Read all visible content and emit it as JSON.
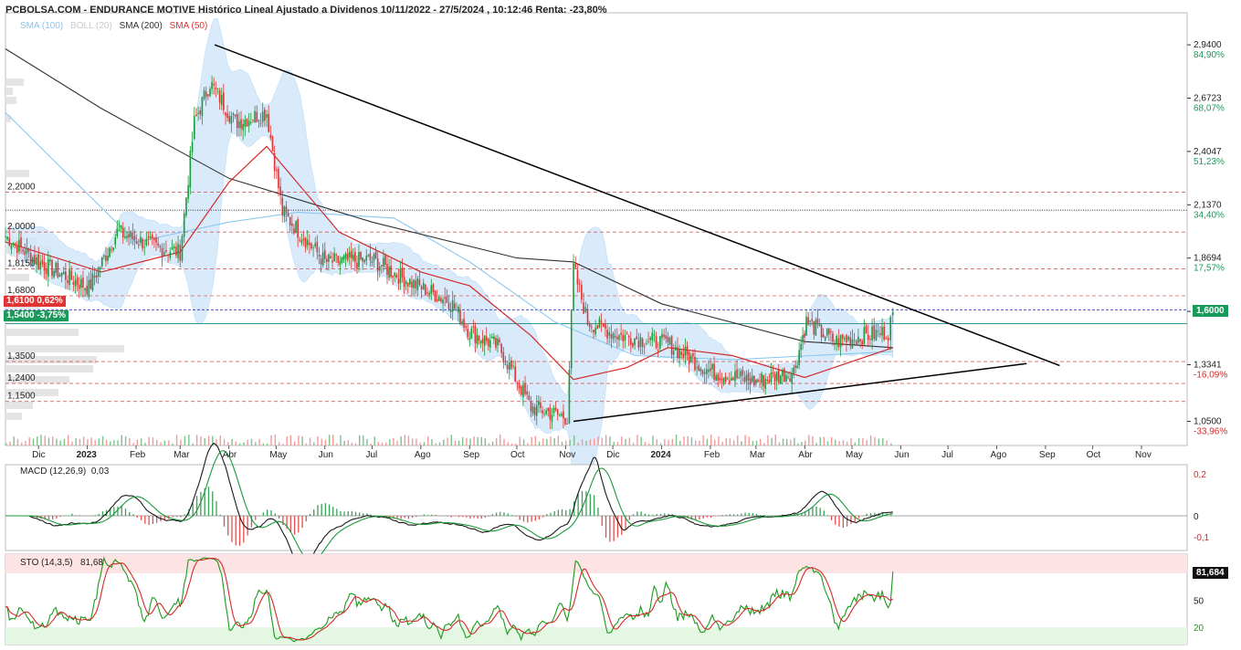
{
  "header": {
    "title": "PCBOLSA.COM - ENDURANCE MOTIVE Histórico Lineal Ajustado a Dividenos 10/11/2022 - 27/5/2024 , 10:12:46 Renta: -23,80%"
  },
  "legend": [
    {
      "label": "SMA (100)",
      "color": "#87c5ef"
    },
    {
      "label": "BOLL (20)",
      "color": "#c9c9c9"
    },
    {
      "label": "SMA (200)",
      "color": "#333333"
    },
    {
      "label": "SMA (50)",
      "color": "#e03030"
    }
  ],
  "colors": {
    "up": "#1a9a3a",
    "down": "#e03333",
    "boll_fill": "#cfe6fa",
    "trend": "#000000",
    "sma200": "#333333",
    "sma50": "#d42a2a",
    "macd_line": "#1a1a1a",
    "signal_line": "#1a9a3a",
    "sto_k": "#1a9a1a",
    "sto_d": "#d42a2a",
    "price_box": "#1a9a5a"
  },
  "price_axis": [
    {
      "value": 2.94,
      "label": "2,9400",
      "pct": "84,90%"
    },
    {
      "value": 2.6723,
      "label": "2,6723",
      "pct": "68,07%"
    },
    {
      "value": 2.4047,
      "label": "2,4047",
      "pct": "51,23%"
    },
    {
      "value": 2.137,
      "label": "2,1370",
      "pct": "34,40%"
    },
    {
      "value": 1.8694,
      "label": "1,8694",
      "pct": "17,57%"
    },
    {
      "value": 1.6017,
      "label": "1,6017",
      "pct": ""
    },
    {
      "value": 1.3341,
      "label": "1,3341",
      "pct": "-16,09%"
    },
    {
      "value": 1.05,
      "label": "1,0500",
      "pct": "-33,96%"
    }
  ],
  "levels": [
    {
      "value": 2.2,
      "label": "2,2000"
    },
    {
      "value": 2.0,
      "label": "2,0000"
    },
    {
      "value": 1.815,
      "label": "1,8150"
    },
    {
      "value": 1.68,
      "label": "1,6800"
    },
    {
      "value": 1.35,
      "label": "1,3500"
    },
    {
      "value": 1.24,
      "label": "1,2400"
    },
    {
      "value": 1.15,
      "label": "1,1500"
    }
  ],
  "price_tags": [
    {
      "value": 1.61,
      "label": "1,6100  0,62%",
      "color": "#e03333"
    },
    {
      "value": 1.54,
      "label": "1,5400  -3,75%",
      "color": "#1a9a5a"
    }
  ],
  "last_price": {
    "value": 1.6,
    "label": "1,6000"
  },
  "ref_line": 2.11,
  "x_axis": [
    {
      "label": "Dic",
      "bold": false
    },
    {
      "label": "2023",
      "bold": true
    },
    {
      "label": "Feb",
      "bold": false
    },
    {
      "label": "Mar",
      "bold": false
    },
    {
      "label": "Abr",
      "bold": false
    },
    {
      "label": "May",
      "bold": false
    },
    {
      "label": "Jun",
      "bold": false
    },
    {
      "label": "Jul",
      "bold": false
    },
    {
      "label": "Ago",
      "bold": false
    },
    {
      "label": "Sep",
      "bold": false
    },
    {
      "label": "Oct",
      "bold": false
    },
    {
      "label": "Nov",
      "bold": false
    },
    {
      "label": "Dic",
      "bold": false
    },
    {
      "label": "2024",
      "bold": true
    },
    {
      "label": "Feb",
      "bold": false
    },
    {
      "label": "Mar",
      "bold": false
    },
    {
      "label": "Abr",
      "bold": false
    },
    {
      "label": "May",
      "bold": false
    },
    {
      "label": "Jun",
      "bold": false
    },
    {
      "label": "Jul",
      "bold": false
    },
    {
      "label": "Ago",
      "bold": false
    },
    {
      "label": "Sep",
      "bold": false
    },
    {
      "label": "Oct",
      "bold": false
    },
    {
      "label": "Nov",
      "bold": false
    }
  ],
  "macd": {
    "title": "MACD (12,26,9)",
    "value": "0,03",
    "ticks": [
      "0,2",
      "0",
      "-0,1"
    ]
  },
  "sto": {
    "title": "STO (14,3,5)",
    "value": "81,68",
    "box": "81,684",
    "ticks": [
      "50",
      "20"
    ]
  },
  "chart_data": {
    "type": "candlestick",
    "title": "ENDURANCE MOTIVE Histórico Lineal Ajustado a Dividenos 10/11/2022 - 27/5/2024",
    "ylim": [
      1.0,
      3.0
    ],
    "anchors": [
      {
        "date": "2022-11-10",
        "close": 1.98
      },
      {
        "date": "2022-12-01",
        "close": 1.85
      },
      {
        "date": "2023-01-02",
        "close": 1.72
      },
      {
        "date": "2023-01-20",
        "close": 2.0
      },
      {
        "date": "2023-02-15",
        "close": 1.92
      },
      {
        "date": "2023-03-01",
        "close": 1.9
      },
      {
        "date": "2023-03-10",
        "close": 2.55
      },
      {
        "date": "2023-03-20",
        "close": 2.75
      },
      {
        "date": "2023-04-05",
        "close": 2.55
      },
      {
        "date": "2023-04-25",
        "close": 2.6
      },
      {
        "date": "2023-05-05",
        "close": 2.1
      },
      {
        "date": "2023-06-01",
        "close": 1.85
      },
      {
        "date": "2023-07-01",
        "close": 1.86
      },
      {
        "date": "2023-07-25",
        "close": 1.75
      },
      {
        "date": "2023-08-20",
        "close": 1.65
      },
      {
        "date": "2023-09-01",
        "close": 1.5
      },
      {
        "date": "2023-09-20",
        "close": 1.42
      },
      {
        "date": "2023-10-10",
        "close": 1.12
      },
      {
        "date": "2023-11-02",
        "close": 1.07
      },
      {
        "date": "2023-11-06",
        "close": 1.82
      },
      {
        "date": "2023-11-15",
        "close": 1.55
      },
      {
        "date": "2023-12-05",
        "close": 1.48
      },
      {
        "date": "2024-01-05",
        "close": 1.44
      },
      {
        "date": "2024-02-01",
        "close": 1.3
      },
      {
        "date": "2024-03-01",
        "close": 1.25
      },
      {
        "date": "2024-03-25",
        "close": 1.3
      },
      {
        "date": "2024-04-02",
        "close": 1.55
      },
      {
        "date": "2024-04-20",
        "close": 1.45
      },
      {
        "date": "2024-05-10",
        "close": 1.48
      },
      {
        "date": "2024-05-24",
        "close": 1.5
      },
      {
        "date": "2024-05-27",
        "close": 1.6
      }
    ],
    "trendlines": [
      {
        "from": {
          "date": "2023-03-23",
          "value": 2.94
        },
        "to": {
          "date": "2024-09-10",
          "value": 1.33
        }
      },
      {
        "from": {
          "date": "2023-11-06",
          "value": 1.05
        },
        "to": {
          "date": "2024-08-20",
          "value": 1.34
        }
      }
    ],
    "sma50": [
      {
        "date": "2022-11-10",
        "value": 1.95
      },
      {
        "date": "2023-01-10",
        "value": 1.8
      },
      {
        "date": "2023-03-01",
        "value": 1.9
      },
      {
        "date": "2023-04-01",
        "value": 2.25
      },
      {
        "date": "2023-04-25",
        "value": 2.43
      },
      {
        "date": "2023-06-10",
        "value": 2.0
      },
      {
        "date": "2023-08-01",
        "value": 1.8
      },
      {
        "date": "2023-09-01",
        "value": 1.73
      },
      {
        "date": "2023-10-10",
        "value": 1.48
      },
      {
        "date": "2023-11-06",
        "value": 1.26
      },
      {
        "date": "2023-12-10",
        "value": 1.32
      },
      {
        "date": "2024-01-05",
        "value": 1.42
      },
      {
        "date": "2024-02-15",
        "value": 1.38
      },
      {
        "date": "2024-04-01",
        "value": 1.27
      },
      {
        "date": "2024-05-27",
        "value": 1.42
      }
    ],
    "sma200": [
      {
        "date": "2022-11-10",
        "value": 2.92
      },
      {
        "date": "2023-01-10",
        "value": 2.62
      },
      {
        "date": "2023-04-01",
        "value": 2.27
      },
      {
        "date": "2023-07-01",
        "value": 2.05
      },
      {
        "date": "2023-10-01",
        "value": 1.87
      },
      {
        "date": "2023-11-06",
        "value": 1.85
      },
      {
        "date": "2024-01-01",
        "value": 1.64
      },
      {
        "date": "2024-04-01",
        "value": 1.45
      },
      {
        "date": "2024-05-27",
        "value": 1.42
      }
    ],
    "sma100": [
      {
        "date": "2022-11-10",
        "value": 2.6
      },
      {
        "date": "2023-02-01",
        "value": 1.95
      },
      {
        "date": "2023-04-01",
        "value": 2.05
      },
      {
        "date": "2023-05-15",
        "value": 2.1
      },
      {
        "date": "2023-07-15",
        "value": 2.07
      },
      {
        "date": "2023-09-01",
        "value": 1.85
      },
      {
        "date": "2023-10-25",
        "value": 1.55
      },
      {
        "date": "2023-12-15",
        "value": 1.38
      },
      {
        "date": "2024-02-15",
        "value": 1.36
      },
      {
        "date": "2024-05-27",
        "value": 1.4
      }
    ],
    "series": [
      {
        "name": "MACD (12,26,9)",
        "last": 0.03
      },
      {
        "name": "STO (14,3,5)",
        "last": 81.68
      }
    ]
  }
}
